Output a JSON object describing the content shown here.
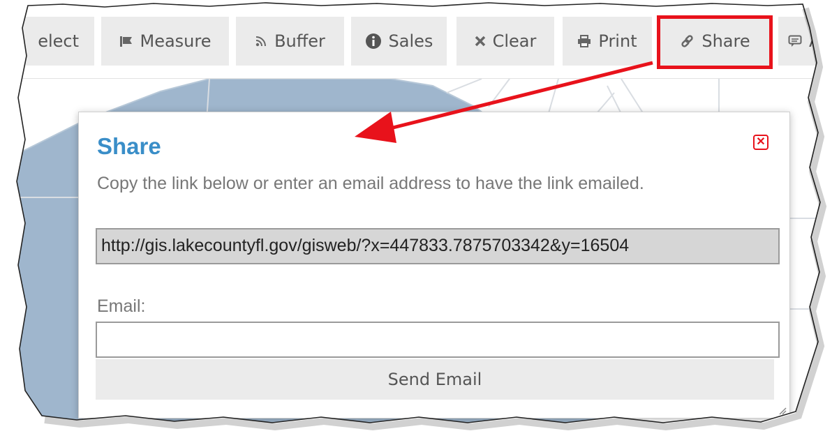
{
  "toolbar": {
    "buttons": [
      {
        "label": "elect",
        "icon": "select-icon"
      },
      {
        "label": "Measure",
        "icon": "flag-icon"
      },
      {
        "label": "Buffer",
        "icon": "rss-icon"
      },
      {
        "label": "Sales",
        "icon": "info-circle-icon"
      },
      {
        "label": "Clear",
        "icon": "close-icon"
      },
      {
        "label": "Print",
        "icon": "print-icon"
      },
      {
        "label": "Share",
        "icon": "link-icon"
      },
      {
        "label": "Al",
        "icon": "comment-icon"
      }
    ]
  },
  "dialog": {
    "title": "Share",
    "description": "Copy the link below or enter an email address to have the link emailed.",
    "link_value": "http://gis.lakecountyfl.gov/gisweb/?x=447833.7875703342&y=16504",
    "email_label": "Email:",
    "email_value": "",
    "send_label": "Send Email",
    "close_icon": "close-icon"
  },
  "colors": {
    "title": "#3a8ec8",
    "highlight": "#e8121b",
    "map_parcel": "#9fb6cd",
    "button_bg": "#ebebeb"
  }
}
